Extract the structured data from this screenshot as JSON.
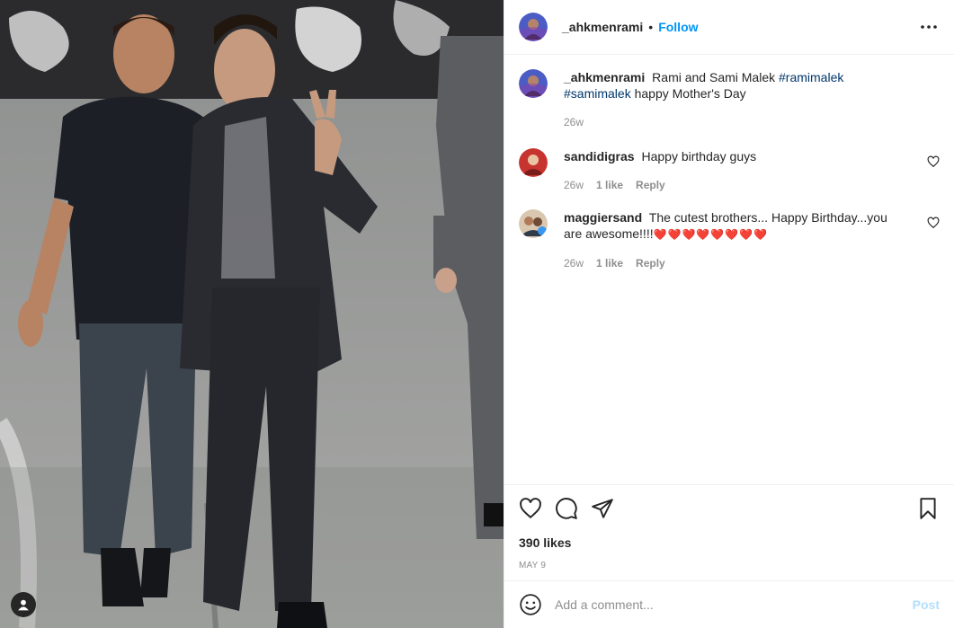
{
  "post": {
    "author": "_ahkmenrami",
    "follow_label": "Follow",
    "separator": "•",
    "caption_text": "Rami and Sami Malek",
    "caption_hashtags": [
      "#ramimalek",
      "#samimalek"
    ],
    "caption_tail": "happy Mother's Day",
    "caption_time": "26w",
    "likes": "390 likes",
    "date": "MAY 9"
  },
  "comments": [
    {
      "user": "sandidigras",
      "text": "Happy birthday guys",
      "time": "26w",
      "likes": "1 like",
      "reply": "Reply"
    },
    {
      "user": "maggiersand",
      "text": "The cutest brothers... Happy Birthday...you are awesome!!!!",
      "hearts": "❤️❤️❤️❤️❤️❤️❤️❤️",
      "time": "26w",
      "likes": "1 like",
      "reply": "Reply"
    }
  ],
  "composer": {
    "placeholder": "Add a comment...",
    "post_label": "Post"
  },
  "colors": {
    "link_blue": "#0095f6",
    "hashtag": "#00376b",
    "muted": "#8e8e8e",
    "post_disabled": "#b2dffc",
    "heart_red": "#e0245e"
  },
  "icons": [
    "more-options-icon",
    "heart-icon",
    "comment-icon",
    "share-icon",
    "bookmark-icon",
    "emoji-icon",
    "user-tag-icon"
  ]
}
